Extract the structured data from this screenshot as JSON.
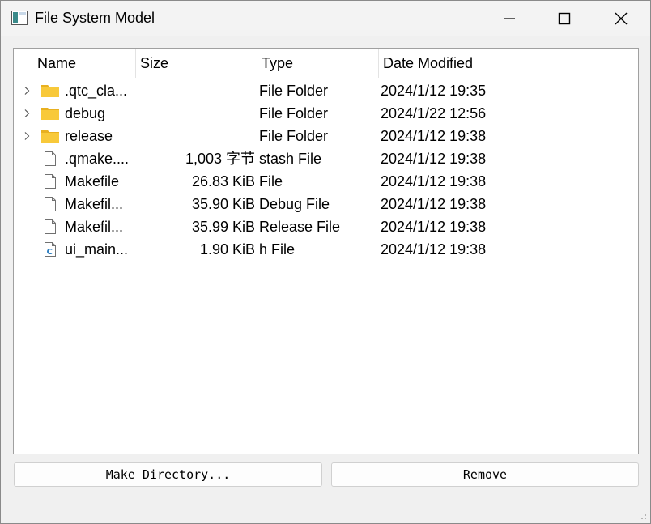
{
  "window": {
    "title": "File System Model"
  },
  "columns": {
    "name": "Name",
    "size": "Size",
    "type": "Type",
    "date": "Date Modified"
  },
  "rows": [
    {
      "name": ".qtc_cla...",
      "size": "",
      "type": "File Folder",
      "date": "2024/1/12 19:35",
      "icon": "folder-icon",
      "expandable": true
    },
    {
      "name": "debug",
      "size": "",
      "type": "File Folder",
      "date": "2024/1/22 12:56",
      "icon": "folder-icon",
      "expandable": true
    },
    {
      "name": "release",
      "size": "",
      "type": "File Folder",
      "date": "2024/1/12 19:38",
      "icon": "folder-icon",
      "expandable": true
    },
    {
      "name": ".qmake....",
      "size": "1,003 字节",
      "type": "stash File",
      "date": "2024/1/12 19:38",
      "icon": "file-icon",
      "expandable": false
    },
    {
      "name": "Makefile",
      "size": "26.83 KiB",
      "type": "File",
      "date": "2024/1/12 19:38",
      "icon": "file-icon",
      "expandable": false
    },
    {
      "name": "Makefil...",
      "size": "35.90 KiB",
      "type": "Debug File",
      "date": "2024/1/12 19:38",
      "icon": "file-icon",
      "expandable": false
    },
    {
      "name": "Makefil...",
      "size": "35.99 KiB",
      "type": "Release File",
      "date": "2024/1/12 19:38",
      "icon": "file-icon",
      "expandable": false
    },
    {
      "name": "ui_main...",
      "size": "1.90 KiB",
      "type": "h File",
      "date": "2024/1/12 19:38",
      "icon": "c-header-file-icon",
      "expandable": false
    }
  ],
  "buttons": {
    "make_directory": "Make Directory...",
    "remove": "Remove"
  },
  "colors": {
    "folder": "#f8c93a",
    "folder_dark": "#e8b020",
    "c_icon": "#2f7fc0"
  }
}
